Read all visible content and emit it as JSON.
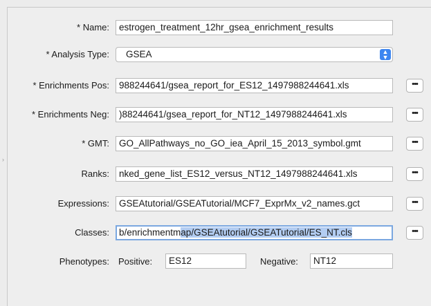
{
  "form": {
    "name": {
      "label": "* Name:",
      "value": "estrogen_treatment_12hr_gsea_enrichment_results"
    },
    "analysis_type": {
      "label": "* Analysis Type:",
      "value": "GSEA"
    },
    "enrichments_pos": {
      "label": "* Enrichments Pos:",
      "value": "988244641/gsea_report_for_ES12_1497988244641.xls"
    },
    "enrichments_neg": {
      "label": "* Enrichments Neg:",
      "value": ")88244641/gsea_report_for_NT12_1497988244641.xls"
    },
    "gmt": {
      "label": "* GMT:",
      "value": "GO_AllPathways_no_GO_iea_April_15_2013_symbol.gmt"
    },
    "ranks": {
      "label": "Ranks:",
      "value": "nked_gene_list_ES12_versus_NT12_1497988244641.xls"
    },
    "expressions": {
      "label": "Expressions:",
      "value": "GSEAtutorial/GSEATutorial/MCF7_ExprMx_v2_names.gct"
    },
    "classes": {
      "label": "Classes:",
      "value_unselected": "b/enrichmentm",
      "value_selected": "ap/GSEAtutorial/GSEATutorial/ES_NT.cls"
    },
    "phenotypes": {
      "label": "Phenotypes:",
      "positive_label": "Positive:",
      "positive_value": "ES12",
      "negative_label": "Negative:",
      "negative_value": "NT12"
    },
    "browse_label": "•••"
  }
}
